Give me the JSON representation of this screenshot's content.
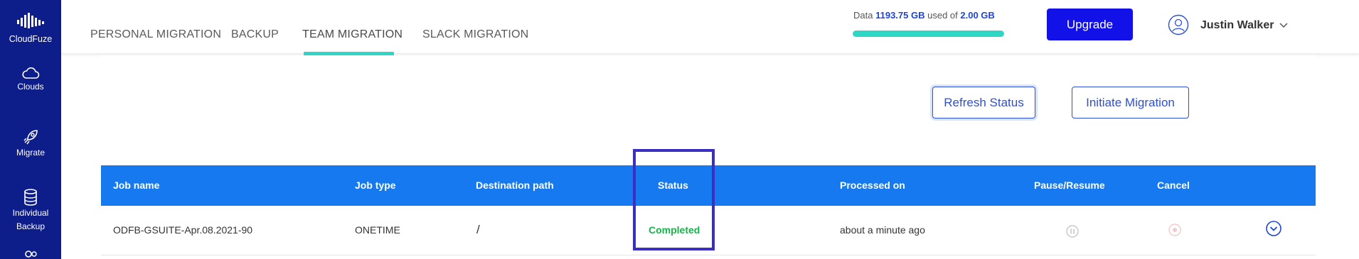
{
  "sidebar": {
    "logo": {
      "label": "CloudFuze",
      "icon": "cloudfuze-logo-icon"
    },
    "items": [
      {
        "label": "Clouds",
        "icon": "cloud-icon"
      },
      {
        "label": "Migrate",
        "icon": "rocket-icon"
      },
      {
        "label_line1": "Individual",
        "label_line2": "Backup",
        "icon": "database-icon"
      }
    ]
  },
  "tabs": [
    {
      "label": "PERSONAL MIGRATION",
      "active": false
    },
    {
      "label": "BACKUP",
      "active": false
    },
    {
      "label": "TEAM MIGRATION",
      "active": true
    },
    {
      "label": "SLACK MIGRATION",
      "active": false
    }
  ],
  "storage": {
    "prefix": "Data",
    "used": "1193.75 GB",
    "middle": "used of",
    "total": "2.00 GB",
    "fill_percent": 100
  },
  "header": {
    "upgrade_label": "Upgrade",
    "user_name": "Justin Walker"
  },
  "actions": {
    "refresh_label": "Refresh Status",
    "initiate_label": "Initiate Migration"
  },
  "table": {
    "columns": [
      "Job name",
      "Job type",
      "Destination path",
      "Status",
      "Processed on",
      "Pause/Resume",
      "Cancel"
    ],
    "rows": [
      {
        "job_name": "ODFB-GSUITE-Apr.08.2021-90",
        "job_type": "ONETIME",
        "destination_path": "/",
        "status": "Completed",
        "processed_on": "about a minute ago"
      }
    ]
  },
  "colors": {
    "sidebar": "#0d1d8a",
    "accent": "#2fd6c6",
    "table_header": "#1679f0",
    "status_completed": "#18b34a",
    "upgrade": "#1212e8"
  }
}
